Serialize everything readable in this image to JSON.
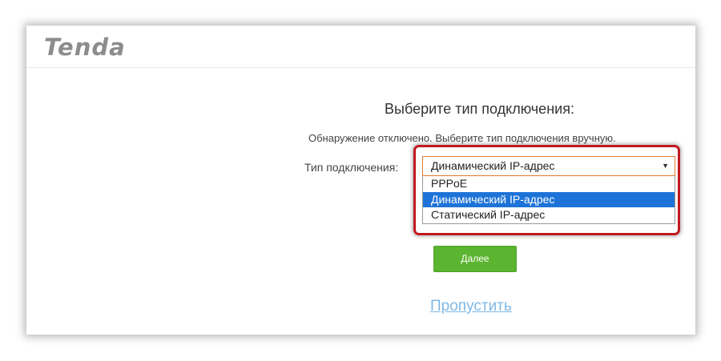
{
  "header": {
    "logo_text": "Tenda"
  },
  "main": {
    "title": "Выберите тип подключения:",
    "notice": "Обнаружение отключено. Выберите тип подключения вручную.",
    "connection_label": "Тип подключения:",
    "select": {
      "value": "Динамический IP-адрес",
      "options": [
        "PPPoE",
        "Динамический IP-адрес",
        "Статический IP-адрес"
      ],
      "selected_index": 1
    },
    "next_button": "Далее",
    "skip_link": "Пропустить"
  },
  "colors": {
    "accent_green": "#5cb531",
    "highlight_red": "#c0191f",
    "option_selected": "#1e73d8",
    "link": "#7fb9e6"
  }
}
